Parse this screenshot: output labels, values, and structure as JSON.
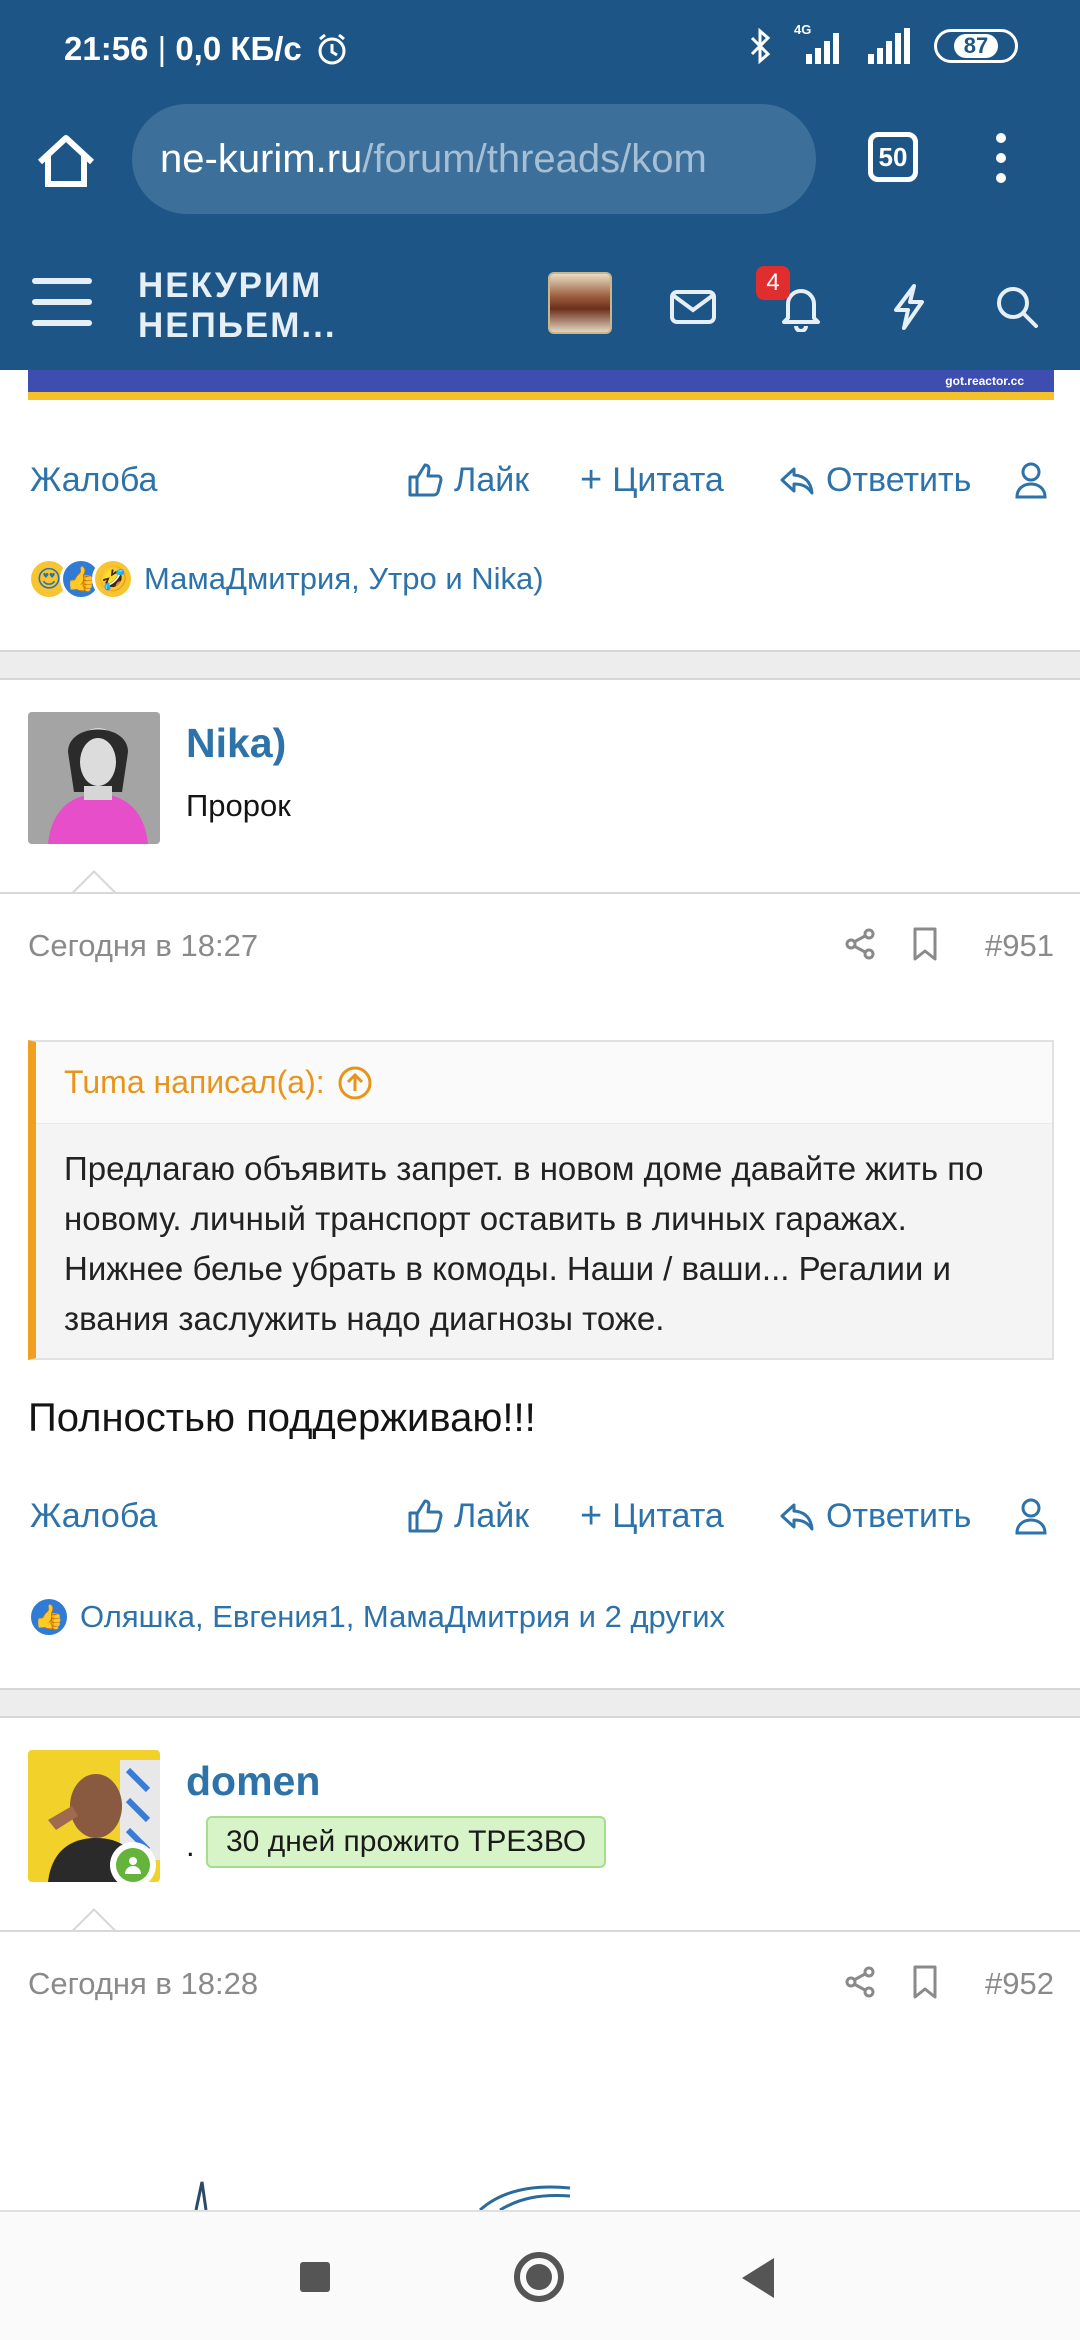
{
  "status": {
    "time": "21:56",
    "speed": "0,0 КБ/с",
    "network": "4G",
    "battery": "87"
  },
  "browser": {
    "url_host": "ne-kurim.ru",
    "url_path": "/forum/threads/kom",
    "tab_count": "50"
  },
  "site": {
    "logo_line1": "НЕКУРИМ",
    "logo_line2": "НЕПЬЕМ...",
    "alerts_count": "4"
  },
  "banner": {
    "credit": "got.reactor.cc"
  },
  "actions": {
    "report": "Жалоба",
    "like": "Лайк",
    "quote": "Цитата",
    "reply": "Ответить"
  },
  "post1_reactions": "МамаДмитрия, Утро и Nika)",
  "post2": {
    "username": "Nika)",
    "title": "Пророк",
    "date": "Сегодня в 18:27",
    "number": "#951",
    "quote_author": "Tuma написал(а):",
    "quote_text": "Предлагаю объявить запрет. в новом доме давайте жить по новому. личный транспорт оставить в личных гаражах. Нижнее белье убрать в комоды. Наши / ваши... Регалии и звания заслужить надо диагнозы тоже.",
    "body": "Полностью поддерживаю!!!",
    "reactions": "Оляшка, Евгения1, МамаДмитрия и 2 других"
  },
  "post3": {
    "username": "domen",
    "dot": ".",
    "badge": "30 дней прожито ТРЕЗВО",
    "date": "Сегодня в 18:28",
    "number": "#952"
  },
  "colors": {
    "header": "#1d5686",
    "link": "#2d72a8",
    "quote_accent": "#f0a020",
    "badge_bg": "#d7f3c8"
  }
}
